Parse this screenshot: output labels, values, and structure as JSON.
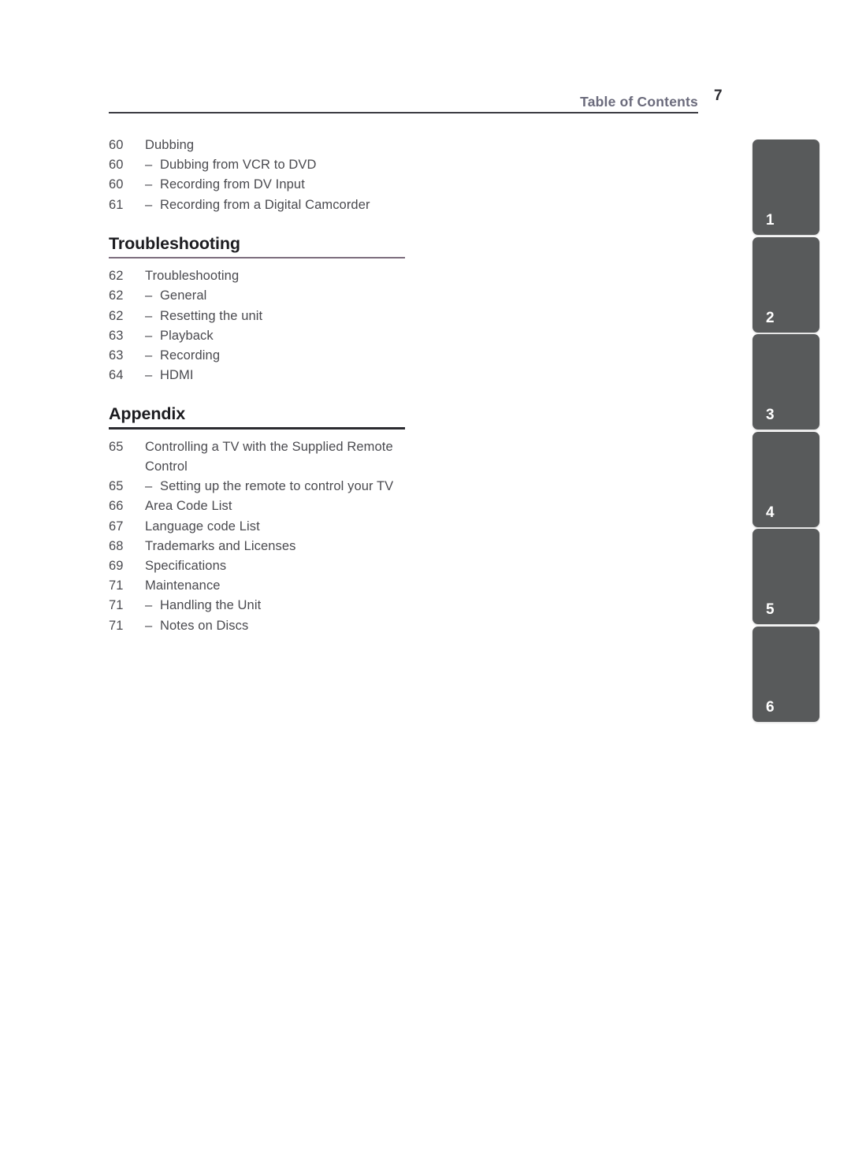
{
  "header": {
    "title": "Table of Contents",
    "page_number": "7"
  },
  "toc": {
    "intro_entries": [
      {
        "page": "60",
        "label": "Dubbing",
        "sub": false
      },
      {
        "page": "60",
        "label": "Dubbing from VCR to DVD",
        "sub": true,
        "dash": "–"
      },
      {
        "page": "60",
        "label": "Recording from DV Input",
        "sub": true,
        "dash": "–"
      },
      {
        "page": "61",
        "label": "Recording from a Digital Camcorder",
        "sub": true,
        "dash": "–"
      }
    ],
    "sections": [
      {
        "heading": "Troubleshooting",
        "rule_color": "#7d6d7e",
        "entries": [
          {
            "page": "62",
            "label": "Troubleshooting",
            "sub": false
          },
          {
            "page": "62",
            "label": "General",
            "sub": true,
            "dash": "–"
          },
          {
            "page": "62",
            "label": "Resetting the unit",
            "sub": true,
            "dash": "–"
          },
          {
            "page": "63",
            "label": "Playback",
            "sub": true,
            "dash": "–"
          },
          {
            "page": "63",
            "label": "Recording",
            "sub": true,
            "dash": "–"
          },
          {
            "page": "64",
            "label": "HDMI",
            "sub": true,
            "dash": "–"
          }
        ]
      },
      {
        "heading": "Appendix",
        "rule_color": "#2b2b30",
        "entries": [
          {
            "page": "65",
            "label": "Controlling a TV with the Supplied Remote Control",
            "sub": false
          },
          {
            "page": "65",
            "label": "Setting up the remote to control your TV",
            "sub": true,
            "dash": "–"
          },
          {
            "page": "66",
            "label": "Area Code List",
            "sub": false
          },
          {
            "page": "67",
            "label": "Language code List",
            "sub": false
          },
          {
            "page": "68",
            "label": "Trademarks and Licenses",
            "sub": false
          },
          {
            "page": "69",
            "label": "Specifications",
            "sub": false
          },
          {
            "page": "71",
            "label": "Maintenance",
            "sub": false
          },
          {
            "page": "71",
            "label": "Handling the Unit",
            "sub": true,
            "dash": "–"
          },
          {
            "page": "71",
            "label": "Notes on Discs",
            "sub": true,
            "dash": "–"
          }
        ]
      }
    ]
  },
  "side_tabs": [
    {
      "number": "1"
    },
    {
      "number": "2"
    },
    {
      "number": "3"
    },
    {
      "number": "4"
    },
    {
      "number": "5"
    },
    {
      "number": "6"
    }
  ],
  "colors": {
    "tab_background": "#585a5b",
    "tab_text": "#ffffff",
    "header_title": "#6b6b7c",
    "body_text": "#4a4a4f",
    "heading_text": "#1c1c20",
    "rule_mauve": "#7d6d7e",
    "rule_dark": "#2b2b30"
  }
}
